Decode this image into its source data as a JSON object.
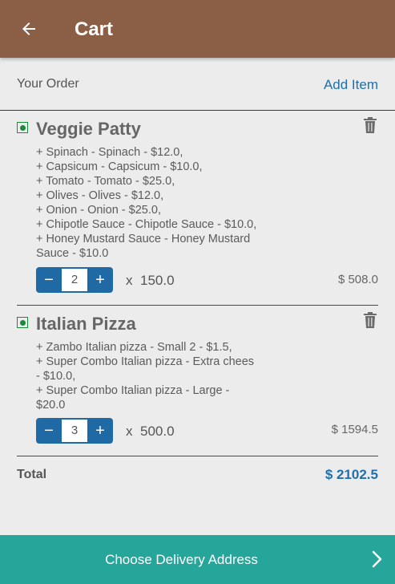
{
  "topbar": {
    "title": "Cart",
    "back_icon": "arrow-left-icon"
  },
  "order_header": {
    "label": "Your Order",
    "add_item": "Add Item"
  },
  "items": [
    {
      "name": "Veggie Patty",
      "addons": [
        "+ Spinach - Spinach - $12.0,",
        "+ Capsicum - Capsicum - $10.0,",
        "+ Tomato - Tomato - $25.0,",
        "+ Olives - Olives - $12.0,",
        "+ Onion - Onion - $25.0,",
        "+ Chipotle Sauce - Chipotle Sauce - $10.0,",
        "+ Honey Mustard Sauce - Honey Mustard",
        "Sauce - $10.0"
      ],
      "quantity": "2",
      "times": "x",
      "unit_price": "150.0",
      "line_total": "$ 508.0"
    },
    {
      "name": "Italian Pizza",
      "addons": [
        "+ Zambo Italian pizza - Small 2 - $1.5,",
        "+ Super Combo Italian pizza - Extra chees",
        "- $10.0,",
        "+ Super Combo Italian pizza - Large -",
        "$20.0"
      ],
      "quantity": "3",
      "times": "x",
      "unit_price": "500.0",
      "line_total": "$ 1594.5"
    }
  ],
  "stepper": {
    "minus": "−",
    "plus": "+"
  },
  "total": {
    "label": "Total",
    "value": "$ 2102.5"
  },
  "bottom_button": {
    "label": "Choose Delivery Address",
    "icon": "chevron-right-icon"
  },
  "colors": {
    "topbar": "#8b5e46",
    "accent_blue": "#1f6fae",
    "stepper": "#1f6aa5",
    "bottom_bar": "#26a69a",
    "veg_green": "#1b8a3c",
    "background": "#ececec"
  }
}
